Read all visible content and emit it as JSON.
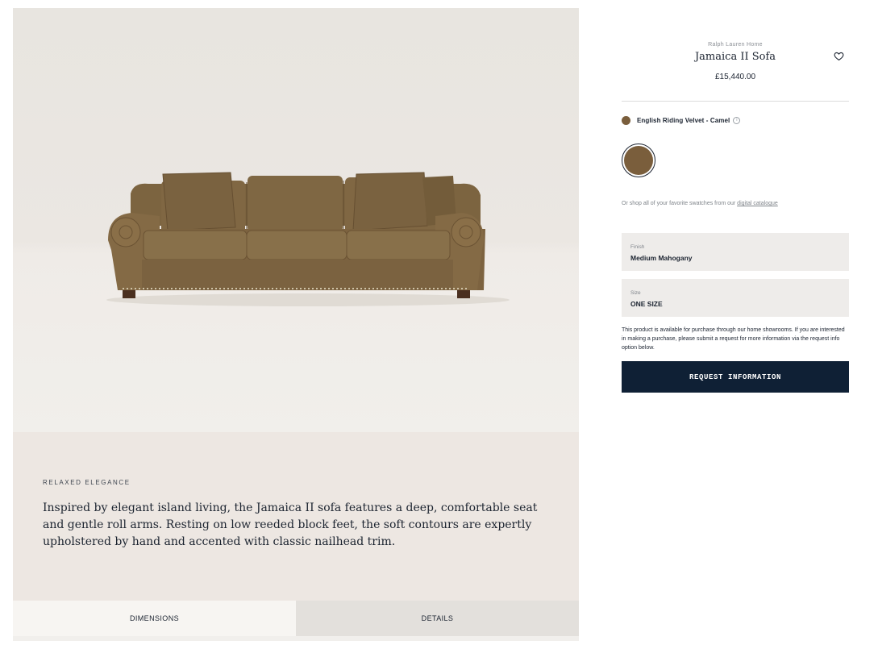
{
  "gallery": {
    "image_alt": "Sofa upholstered in camel velvet with rolled arms, four cushions and nailhead trim"
  },
  "story": {
    "eyebrow": "RELAXED ELEGANCE",
    "text": "Inspired by elegant island living, the Jamaica II sofa features a deep, comfortable seat and gentle roll arms. Resting on low reeded block feet, the soft contours are expertly upholstered by hand and accented with classic nailhead trim."
  },
  "tabs": [
    {
      "label": "DIMENSIONS",
      "active": true
    },
    {
      "label": "DETAILS",
      "active": false
    }
  ],
  "product": {
    "brand": "Ralph Lauren Home",
    "title": "Jamaica II Sofa",
    "price": "£15,440.00",
    "wishlist_icon": "heart-icon"
  },
  "swatch": {
    "label": "English Riding Velvet - Camel",
    "color": "#7a5e3c",
    "info_icon": "info-icon"
  },
  "catalogue": {
    "prefix": "Or shop all of your favorite swatches from our ",
    "link": "digital catalogue"
  },
  "finish": {
    "label": "Finish",
    "value": "Medium Mahogany"
  },
  "size": {
    "label": "Size",
    "value": "ONE SIZE"
  },
  "purchase_note": "This product is available for purchase through our home showrooms. If you are interested in making a purchase, please submit a request for more information via the request info option below.",
  "cta": {
    "label": "REQUEST INFORMATION",
    "color": "#0f2035"
  }
}
